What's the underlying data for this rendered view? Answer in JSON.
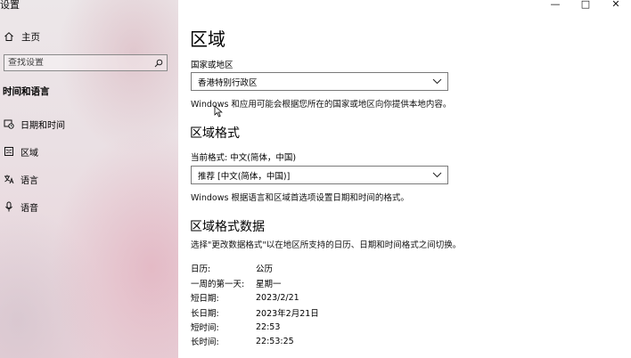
{
  "window": {
    "title": "设置",
    "controls": {
      "minimize": "—",
      "maximize": "□",
      "close": "✕"
    }
  },
  "sidebar": {
    "home": {
      "label": "主页",
      "icon": "home-icon"
    },
    "search": {
      "placeholder": "查找设置",
      "icon": "search-icon"
    },
    "section_title": "时间和语言",
    "items": [
      {
        "label": "日期和时间",
        "icon": "calendar-clock-icon"
      },
      {
        "label": "区域",
        "icon": "globe-icon"
      },
      {
        "label": "语言",
        "icon": "language-icon"
      },
      {
        "label": "语音",
        "icon": "microphone-icon"
      }
    ]
  },
  "main": {
    "page_title": "区域",
    "country": {
      "label": "国家或地区",
      "value": "香港特别行政区",
      "description": "Windows 和应用可能会根据您所在的国家或地区向你提供本地内容。"
    },
    "format": {
      "heading": "区域格式",
      "current_label": "当前格式: 中文(简体，中国)",
      "value": "推荐 [中文(简体，中国)]",
      "description": "Windows 根据语言和区域首选项设置日期和时间的格式。"
    },
    "format_data": {
      "heading": "区域格式数据",
      "description": "选择\"更改数据格式\"以在地区所支持的日历、日期和时间格式之间切换。",
      "rows": [
        {
          "key": "日历:",
          "value": "公历"
        },
        {
          "key": "一周的第一天:",
          "value": "星期一"
        },
        {
          "key": "短日期:",
          "value": "2023/2/21"
        },
        {
          "key": "长日期:",
          "value": "2023年2月21日"
        },
        {
          "key": "短时间:",
          "value": "22:53"
        },
        {
          "key": "长时间:",
          "value": "22:53:25"
        }
      ]
    }
  },
  "colors": {
    "sidebar_tint": "#e8d2d9",
    "border": "#7a7a7a",
    "text": "#000000"
  }
}
